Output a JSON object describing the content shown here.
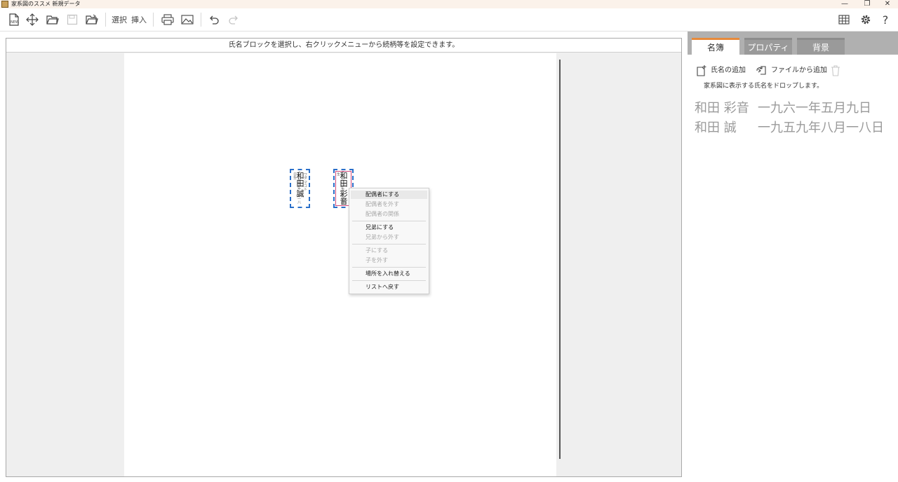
{
  "window": {
    "title": "家系図のススメ 新規データ",
    "controls": [
      "—",
      "❐",
      "✕"
    ]
  },
  "toolbar": {
    "new_label": "NEW",
    "select_label": "選択",
    "insert_label": "挿入"
  },
  "canvas": {
    "hint": "氏名ブロックを選択し、右クリックメニューから続柄等を設定できます。",
    "blocks": [
      {
        "name": "和田 誠",
        "yomi": "ワダ マコト",
        "date": "一九五九年八月一八日生"
      },
      {
        "name": "和田 彩音",
        "yomi": "",
        "date": "一九六一年五月九日生"
      }
    ]
  },
  "context_menu": {
    "items": [
      {
        "label": "配偶者にする",
        "enabled": true
      },
      {
        "label": "配偶者を外す",
        "enabled": false
      },
      {
        "label": "配偶者の関係",
        "enabled": false
      },
      {
        "label": "兄弟にする",
        "enabled": true
      },
      {
        "label": "兄弟から外す",
        "enabled": false
      },
      {
        "label": "子にする",
        "enabled": false
      },
      {
        "label": "子を外す",
        "enabled": false
      },
      {
        "label": "場所を入れ替える",
        "enabled": true
      },
      {
        "label": "リストへ戻す",
        "enabled": true
      }
    ]
  },
  "panel": {
    "tabs": [
      "名簿",
      "プロパティ",
      "背景"
    ],
    "active_tab": "名簿",
    "add_name_label": "氏名の追加",
    "add_file_label": "ファイルから追加",
    "drop_hint": "家系図に表示する氏名をドロップします。",
    "roster": [
      {
        "name": "和田 彩音",
        "date": "一九六一年五月九日"
      },
      {
        "name": "和田 誠",
        "date": "一九五九年八月一八日"
      }
    ]
  },
  "colors": {
    "accent_tab": "#e78a3b",
    "block_border": "#2a6fc9",
    "selected_inner": "#d04a7a"
  }
}
